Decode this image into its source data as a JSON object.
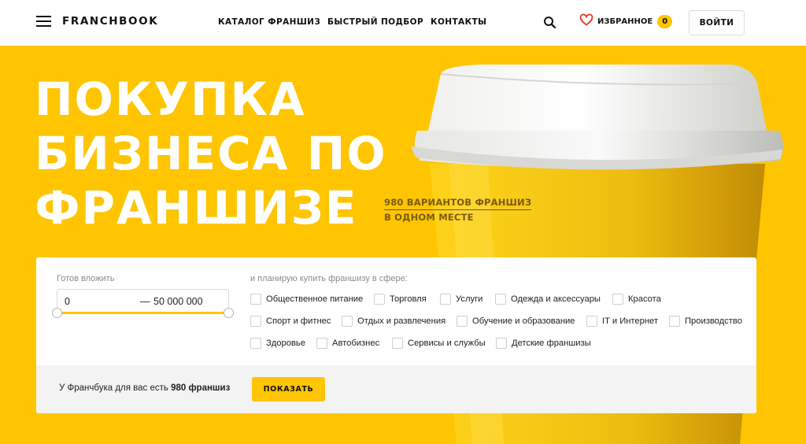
{
  "header": {
    "logo": "FRANCHBOOK",
    "nav": [
      "КАТАЛОГ ФРАНШИЗ",
      "БЫСТРЫЙ ПОДБОР",
      "КОНТАКТЫ"
    ],
    "favorites_label": "ИЗБРАННОЕ",
    "favorites_count": "0",
    "login_label": "ВОЙТИ",
    "icons": [
      "menu-icon",
      "search-icon",
      "heart-icon"
    ]
  },
  "hero": {
    "title_lines": [
      "ПОКУПКА",
      "БИЗНЕСА ПО",
      "ФРАНШИЗЕ"
    ],
    "subtitle_line1": "980 ВАРИАНТОВ ФРАНШИЗ",
    "subtitle_line2": "В ОДНОМ МЕСТЕ"
  },
  "filter": {
    "invest_label": "Готов вложить",
    "range_from": "0",
    "range_dash": "—",
    "range_to": "50 000 000",
    "sphere_label": "и планирую купить франшизу в сфере:",
    "categories": [
      [
        "Общественное питание",
        "Торговля",
        "Услуги",
        "Одежда и аксессуары",
        "Красота"
      ],
      [
        "Спорт и фитнес",
        "Отдых и развлечения",
        "Обучение и образование",
        "IT и Интернет",
        "Производство"
      ],
      [
        "Здоровье",
        "Автобизнес",
        "Сервисы и службы",
        "Детские франшизы"
      ]
    ],
    "found_text": "У Франчбука для вас есть",
    "found_count": "980 франшиз",
    "show_label": "ПОКАЗАТЬ"
  },
  "colors": {
    "accent": "#ffc500",
    "hero_text": "#ffffff",
    "subtitle": "#7a5a12",
    "panel_footer": "#f3f3f3"
  }
}
